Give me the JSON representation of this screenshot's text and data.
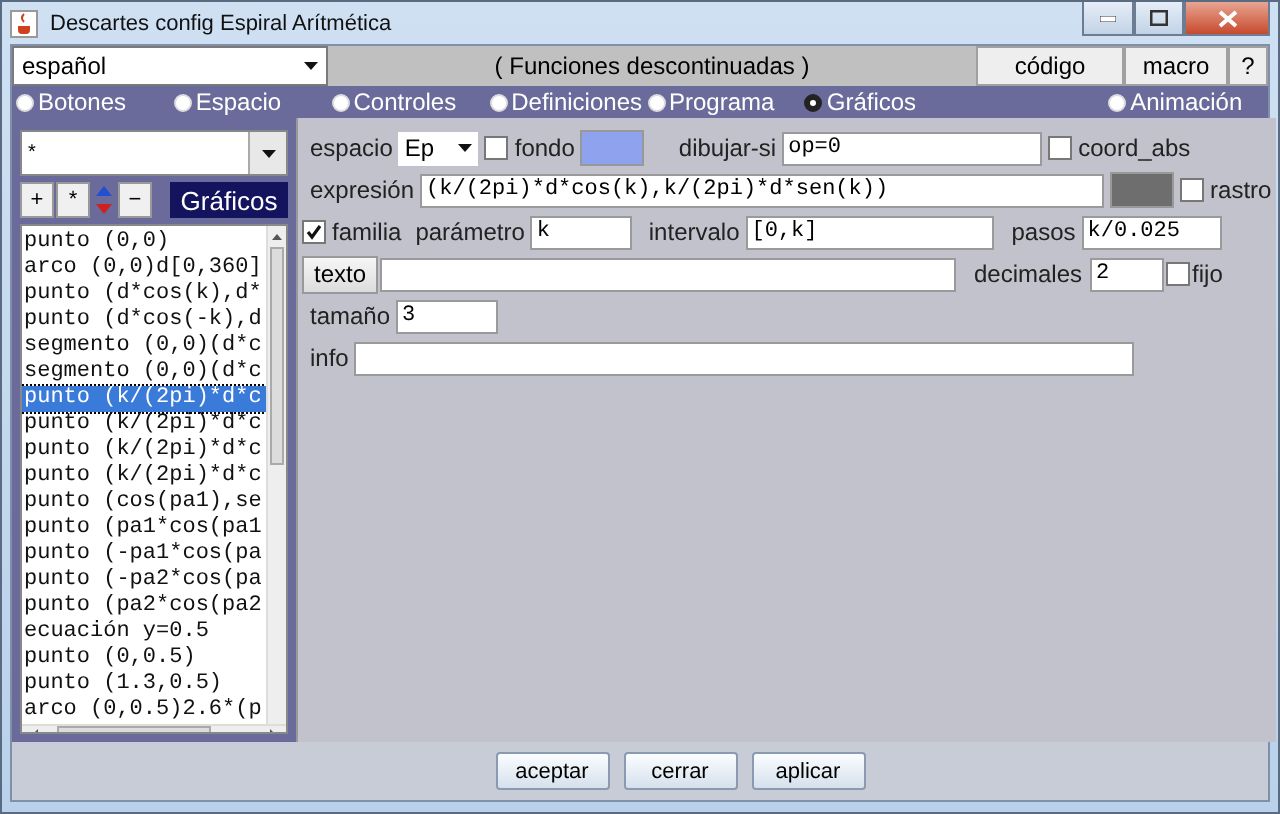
{
  "window": {
    "title": "Descartes config Espiral Arítmética"
  },
  "toolbar": {
    "language": "español",
    "status": "( Funciones  descontinuadas )",
    "buttons": [
      "código",
      "macro",
      "?"
    ]
  },
  "tabs": [
    {
      "label": "Botones",
      "selected": false
    },
    {
      "label": "Espacio",
      "selected": false
    },
    {
      "label": "Controles",
      "selected": false
    },
    {
      "label": "Definiciones",
      "selected": false
    },
    {
      "label": "Programa",
      "selected": false
    },
    {
      "label": "Gráficos",
      "selected": true
    },
    {
      "label": "Animación",
      "selected": false
    }
  ],
  "left_panel": {
    "filter": "*",
    "buttons": [
      "+",
      "*",
      "−"
    ],
    "heading": "Gráficos",
    "items": [
      {
        "text": "punto (0,0)",
        "selected": false
      },
      {
        "text": "arco (0,0)d[0,360]",
        "selected": false
      },
      {
        "text": "punto (d*cos(k),d*",
        "selected": false
      },
      {
        "text": "punto (d*cos(-k),d",
        "selected": false
      },
      {
        "text": "segmento (0,0)(d*c",
        "selected": false
      },
      {
        "text": "segmento (0,0)(d*c",
        "selected": false
      },
      {
        "text": "punto (k/(2pi)*d*c",
        "selected": true
      },
      {
        "text": "punto (k/(2pi)*d*c",
        "selected": false
      },
      {
        "text": "punto (k/(2pi)*d*c",
        "selected": false
      },
      {
        "text": "punto (k/(2pi)*d*c",
        "selected": false
      },
      {
        "text": "punto (cos(pa1),se",
        "selected": false
      },
      {
        "text": "punto (pa1*cos(pa1",
        "selected": false
      },
      {
        "text": "punto (-pa1*cos(pa",
        "selected": false
      },
      {
        "text": "punto (-pa2*cos(pa",
        "selected": false
      },
      {
        "text": "punto (pa2*cos(pa2",
        "selected": false
      },
      {
        "text": "ecuación y=0.5",
        "selected": false
      },
      {
        "text": "punto (0,0.5)",
        "selected": false
      },
      {
        "text": "punto (1.3,0.5)",
        "selected": false
      },
      {
        "text": "arco (0,0.5)2.6*(p",
        "selected": false
      }
    ]
  },
  "form": {
    "espacio": {
      "label": "espacio",
      "value": "Ep"
    },
    "fondo": {
      "label": "fondo",
      "checked": false,
      "color": "#8ea2ee"
    },
    "dibujar_si": {
      "label": "dibujar-si",
      "value": "op=0"
    },
    "coord_abs": {
      "label": "coord_abs",
      "checked": false
    },
    "expresion": {
      "label": "expresión",
      "value": "(k/(2pi)*d*cos(k),k/(2pi)*d*sen(k))",
      "color": "#6e6e6e"
    },
    "rastro": {
      "label": "rastro",
      "checked": false
    },
    "familia": {
      "label": "familia",
      "checked": true
    },
    "parametro": {
      "label": "parámetro",
      "value": "k"
    },
    "intervalo": {
      "label": "intervalo",
      "value": "[0,k]"
    },
    "pasos": {
      "label": "pasos",
      "value": "k/0.025"
    },
    "texto": {
      "label": "texto"
    },
    "decimales": {
      "label": "decimales",
      "value": "2"
    },
    "fijo": {
      "label": "fijo",
      "checked": false
    },
    "tamano": {
      "label": "tamaño",
      "value": "3"
    },
    "info": {
      "label": "info"
    }
  },
  "footer": {
    "buttons": [
      "aceptar",
      "cerrar",
      "aplicar"
    ]
  }
}
